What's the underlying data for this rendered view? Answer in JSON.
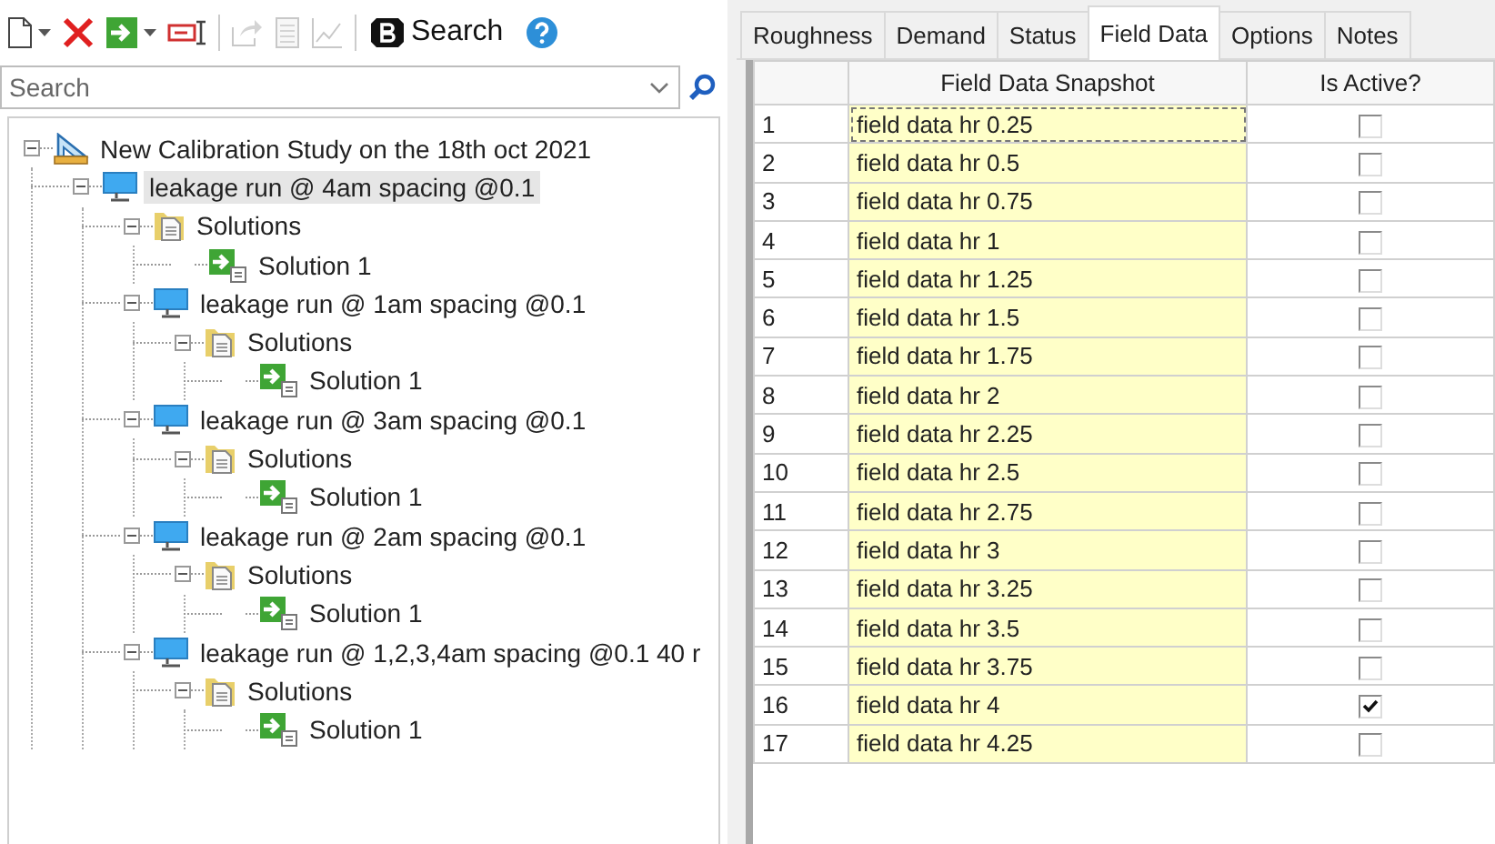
{
  "toolbar": {
    "tools": [
      {
        "kind": "new",
        "disabled": false,
        "dropdown": true
      },
      {
        "kind": "delete",
        "disabled": false,
        "dropdown": false
      },
      {
        "kind": "compute",
        "disabled": false,
        "dropdown": true
      },
      {
        "kind": "rename",
        "disabled": false,
        "dropdown": false
      },
      {
        "kind": "separator"
      },
      {
        "kind": "export",
        "disabled": true,
        "dropdown": false
      },
      {
        "kind": "report",
        "disabled": true,
        "dropdown": false
      },
      {
        "kind": "graph",
        "disabled": true,
        "dropdown": false
      },
      {
        "kind": "separator"
      }
    ],
    "search_button": "Search"
  },
  "search": {
    "placeholder": "Search"
  },
  "tree": [
    {
      "label": "New Calibration Study on the 18th oct 2021",
      "kind": "study",
      "selected": false,
      "expanded": true,
      "children": [
        {
          "label": "leakage run @ 4am  spacing @0.1",
          "kind": "run",
          "selected": true,
          "expanded": true,
          "children": [
            {
              "label": "Solutions",
              "kind": "folder",
              "selected": false,
              "expanded": true,
              "children": [
                {
                  "label": "Solution 1",
                  "kind": "solution",
                  "selected": false
                }
              ]
            },
            {
              "label": "leakage run @ 1am  spacing @0.1",
              "kind": "run",
              "selected": false,
              "expanded": true,
              "children": [
                {
                  "label": "Solutions",
                  "kind": "folder",
                  "selected": false,
                  "expanded": true,
                  "children": [
                    {
                      "label": "Solution 1",
                      "kind": "solution",
                      "selected": false
                    }
                  ]
                }
              ]
            },
            {
              "label": "leakage run @ 3am  spacing @0.1",
              "kind": "run",
              "selected": false,
              "expanded": true,
              "children": [
                {
                  "label": "Solutions",
                  "kind": "folder",
                  "selected": false,
                  "expanded": true,
                  "children": [
                    {
                      "label": "Solution 1",
                      "kind": "solution",
                      "selected": false
                    }
                  ]
                }
              ]
            },
            {
              "label": "leakage run @ 2am  spacing @0.1",
              "kind": "run",
              "selected": false,
              "expanded": true,
              "children": [
                {
                  "label": "Solutions",
                  "kind": "folder",
                  "selected": false,
                  "expanded": true,
                  "children": [
                    {
                      "label": "Solution 1",
                      "kind": "solution",
                      "selected": false
                    }
                  ]
                }
              ]
            },
            {
              "label": "leakage run @ 1,2,3,4am  spacing @0.1 40 r",
              "kind": "run",
              "selected": false,
              "expanded": true,
              "children": [
                {
                  "label": "Solutions",
                  "kind": "folder",
                  "selected": false,
                  "expanded": true,
                  "children": [
                    {
                      "label": "Solution 1",
                      "kind": "solution",
                      "selected": false
                    }
                  ]
                }
              ]
            }
          ]
        }
      ]
    }
  ],
  "tabs": [
    {
      "label": "Roughness",
      "selected": false
    },
    {
      "label": "Demand",
      "selected": false
    },
    {
      "label": "Status",
      "selected": false
    },
    {
      "label": "Field Data",
      "selected": true
    },
    {
      "label": "Options",
      "selected": false
    },
    {
      "label": "Notes",
      "selected": false
    }
  ],
  "table": {
    "columns": [
      "Field Data Snapshot",
      "Is Active?"
    ],
    "rows": [
      {
        "number": "1",
        "snapshot": "field data hr 0.25",
        "active": false,
        "focused": true
      },
      {
        "number": "2",
        "snapshot": "field data hr 0.5",
        "active": false,
        "focused": false
      },
      {
        "number": "3",
        "snapshot": "field data hr 0.75",
        "active": false,
        "focused": false
      },
      {
        "number": "4",
        "snapshot": "field data hr 1",
        "active": false,
        "focused": false
      },
      {
        "number": "5",
        "snapshot": "field data hr 1.25",
        "active": false,
        "focused": false
      },
      {
        "number": "6",
        "snapshot": "field data hr 1.5",
        "active": false,
        "focused": false
      },
      {
        "number": "7",
        "snapshot": "field data hr 1.75",
        "active": false,
        "focused": false
      },
      {
        "number": "8",
        "snapshot": "field data hr 2",
        "active": false,
        "focused": false
      },
      {
        "number": "9",
        "snapshot": "field data hr 2.25",
        "active": false,
        "focused": false
      },
      {
        "number": "10",
        "snapshot": "field data hr 2.5",
        "active": false,
        "focused": false
      },
      {
        "number": "11",
        "snapshot": "field data hr 2.75",
        "active": false,
        "focused": false
      },
      {
        "number": "12",
        "snapshot": "field data hr 3",
        "active": false,
        "focused": false
      },
      {
        "number": "13",
        "snapshot": "field data hr 3.25",
        "active": false,
        "focused": false
      },
      {
        "number": "14",
        "snapshot": "field data hr 3.5",
        "active": false,
        "focused": false
      },
      {
        "number": "15",
        "snapshot": "field data hr 3.75",
        "active": false,
        "focused": false
      },
      {
        "number": "16",
        "snapshot": "field data hr 4",
        "active": true,
        "focused": false
      },
      {
        "number": "17",
        "snapshot": "field data hr 4.25",
        "active": false,
        "focused": false
      }
    ]
  }
}
